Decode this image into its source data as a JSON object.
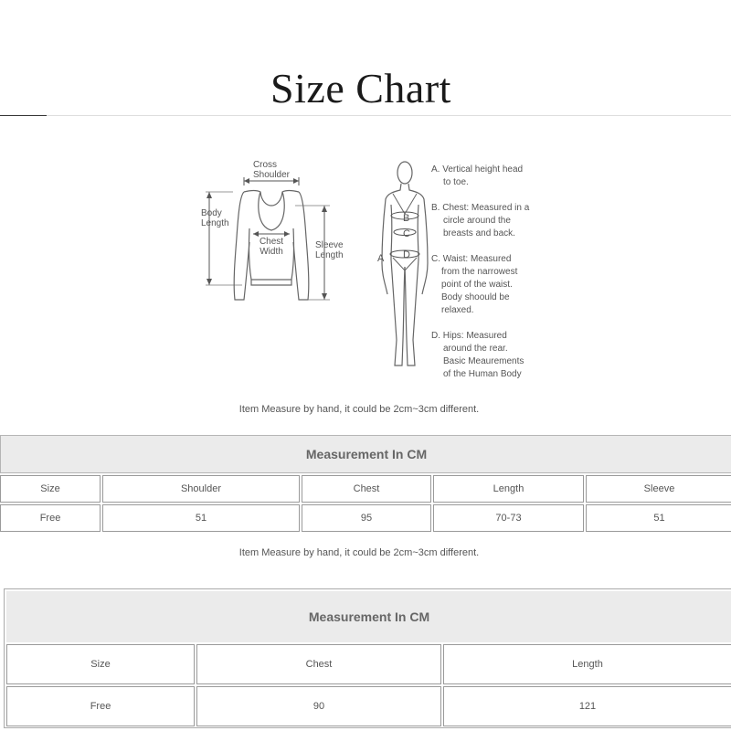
{
  "title": "Size Chart",
  "figure": {
    "sweater_labels": {
      "cross_shoulder": [
        "Cross",
        "Shoulder"
      ],
      "body_length": [
        "Body",
        "Length"
      ],
      "chest_width": [
        "Chest",
        "Width"
      ],
      "sleeve_length": [
        "Sleeve",
        "Length"
      ]
    },
    "body_markers": {
      "a": "A",
      "b": "B",
      "c": "C",
      "d": "D"
    },
    "legend": [
      [
        "A. Vertical height head",
        "to toe."
      ],
      [
        "B. Chest: Measured in a",
        "circle around the",
        "breasts and back."
      ],
      [
        "C. Waist: Measured",
        "from the narrowest",
        "point of the waist.",
        "Body shoould be",
        "relaxed."
      ],
      [
        "D. Hips: Measured",
        "around the rear.",
        "Basic Meaurements",
        "of the Human Body"
      ]
    ]
  },
  "note_1": "Item Measure by hand, it could be 2cm~3cm different.",
  "table_1": {
    "header": "Measurement In CM",
    "columns": [
      "Size",
      "Shoulder",
      "Chest",
      "Length",
      "Sleeve"
    ],
    "rows": [
      [
        "Free",
        "51",
        "95",
        "70-73",
        "51"
      ]
    ]
  },
  "note_2": "Item Measure by hand, it could be 2cm~3cm different.",
  "table_2": {
    "header": "Measurement In CM",
    "columns": [
      "Size",
      "Chest",
      "Length"
    ],
    "rows": [
      [
        "Free",
        "90",
        "121"
      ]
    ]
  }
}
